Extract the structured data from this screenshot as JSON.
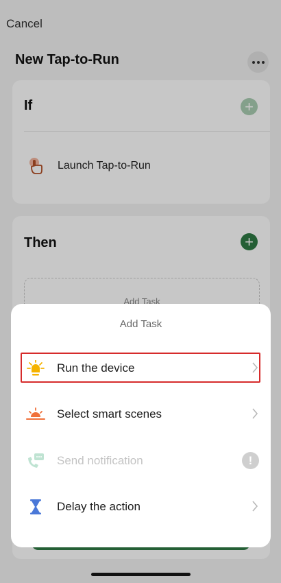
{
  "header": {
    "cancel_label": "Cancel",
    "title": "New Tap-to-Run"
  },
  "if_section": {
    "heading": "If",
    "condition_label": "Launch Tap-to-Run"
  },
  "then_section": {
    "heading": "Then",
    "add_task_placeholder": "Add Task"
  },
  "sheet": {
    "title": "Add Task",
    "options": [
      {
        "label": "Run the device",
        "icon": "bulb-icon",
        "enabled": true,
        "selected": true
      },
      {
        "label": "Select smart scenes",
        "icon": "sunrise-icon",
        "enabled": true
      },
      {
        "label": "Send notification",
        "icon": "phone-message-icon",
        "enabled": false,
        "warning": "!"
      },
      {
        "label": "Delay the action",
        "icon": "hourglass-icon",
        "enabled": true
      }
    ]
  },
  "colors": {
    "accent_green": "#2f7a44",
    "highlight_red": "#d62b2b",
    "bulb_yellow": "#f5b300",
    "sunrise_orange": "#f0703a",
    "hourglass_blue": "#4a78d8"
  }
}
